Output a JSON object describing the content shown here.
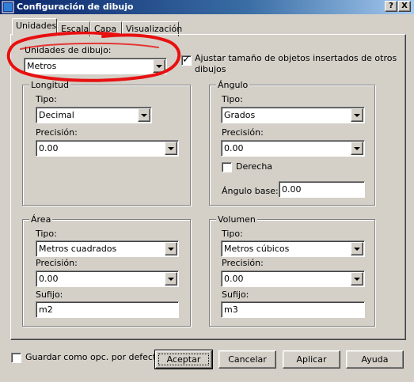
{
  "window": {
    "title": "Configuración de dibujo",
    "help_button": "?",
    "close_button": "X"
  },
  "tabs": [
    {
      "label": "Unidades"
    },
    {
      "label": "Escala"
    },
    {
      "label": "Capa"
    },
    {
      "label": "Visualización"
    }
  ],
  "drawing_units": {
    "label": "Unidades de dibujo:",
    "value": "Metros",
    "scale_checkbox_label_line1": "Ajustar tamaño de objetos insertados de otros",
    "scale_checkbox_label_line2": "dibujos",
    "scale_checked": true
  },
  "length": {
    "legend": "Longitud",
    "type_label": "Tipo:",
    "type_value": "Decimal",
    "precision_label": "Precisión:",
    "precision_value": "0.00"
  },
  "angle": {
    "legend": "Ángulo",
    "type_label": "Tipo:",
    "type_value": "Grados",
    "precision_label": "Precisión:",
    "precision_value": "0.00",
    "clockwise_label": "Derecha",
    "clockwise_checked": false,
    "base_label": "Ángulo base:",
    "base_value": "0.00"
  },
  "area": {
    "legend": "Área",
    "type_label": "Tipo:",
    "type_value": "Metros cuadrados",
    "precision_label": "Precisión:",
    "precision_value": "0.00",
    "suffix_label": "Sufijo:",
    "suffix_value": "m2"
  },
  "volume": {
    "legend": "Volumen",
    "type_label": "Tipo:",
    "type_value": "Metros cúbicos",
    "precision_label": "Precisión:",
    "precision_value": "0.00",
    "suffix_label": "Sufijo:",
    "suffix_value": "m3"
  },
  "footer": {
    "save_default_label": "Guardar como opc. por defecto",
    "save_default_checked": false,
    "ok": "Aceptar",
    "cancel": "Cancelar",
    "apply": "Aplicar",
    "help": "Ayuda"
  },
  "colors": {
    "dialog": "#d4d0c8",
    "titlebar_start": "#0a246a",
    "titlebar_end": "#a6caf0",
    "annotation": "#e81010"
  }
}
